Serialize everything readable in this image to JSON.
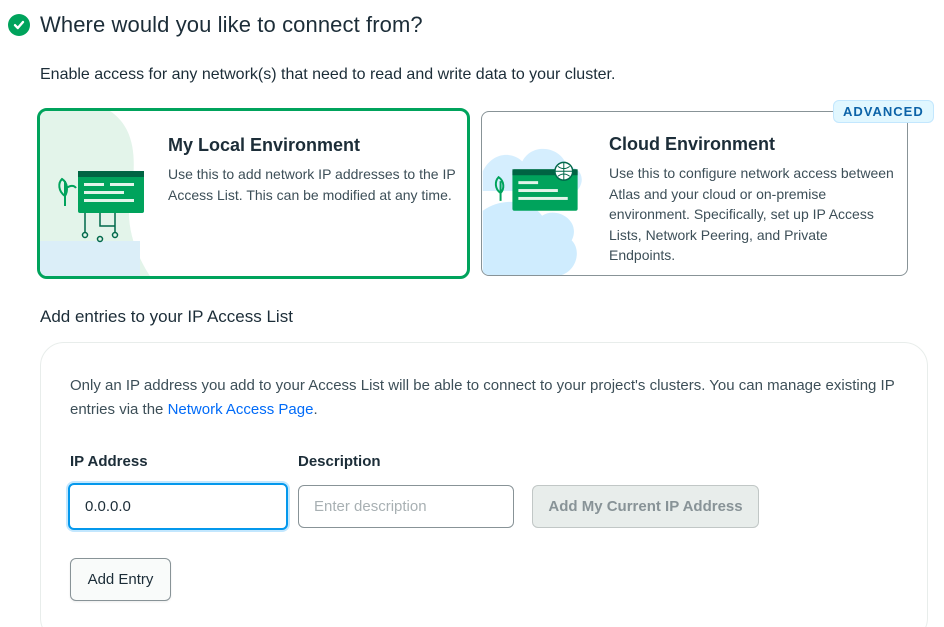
{
  "header": {
    "title": "Where would you like to connect from?",
    "check_icon": "check-circle-icon",
    "check_color": "#00a35c"
  },
  "subtitle": "Enable access for any network(s) that need to read and write data to your cluster.",
  "options": {
    "local": {
      "title": "My Local Environment",
      "description": "Use this to add network IP addresses to the IP Access List. This can be modified at any time.",
      "selected": true
    },
    "cloud": {
      "title": "Cloud Environment",
      "description": "Use this to configure network access between Atlas and your cloud or on-premise environment. Specifically, set up IP Access Lists, Network Peering, and Private Endpoints.",
      "badge": "ADVANCED",
      "selected": false
    }
  },
  "access_list": {
    "section_title": "Add entries to your IP Access List",
    "info_text": "Only an IP address you add to your Access List will be able to connect to your project's clusters. You can manage existing IP entries via the ",
    "info_link": "Network Access Page",
    "info_suffix": ".",
    "ip_label": "IP Address",
    "ip_value": "0.0.0.0",
    "description_label": "Description",
    "description_placeholder": "Enter description",
    "add_current_ip_label": "Add My Current IP Address",
    "add_entry_label": "Add Entry"
  },
  "colors": {
    "accent_green": "#00a35c",
    "link_blue": "#016bf8",
    "focus_blue": "#0498ec"
  }
}
